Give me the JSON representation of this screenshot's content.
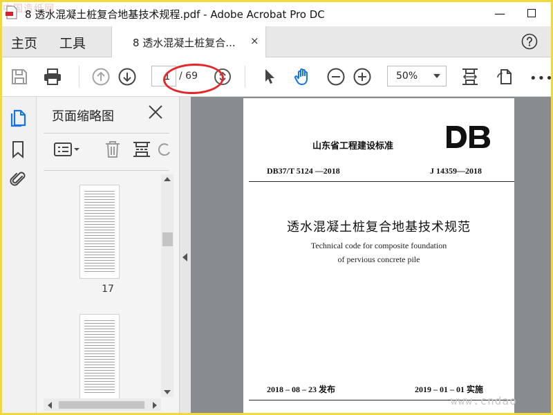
{
  "window": {
    "title": "8 透水混凝土桩复合地基技术规程.pdf - Adobe Acrobat Pro DC",
    "minimize_label": "—",
    "maximize_label": "☐"
  },
  "watermarks": {
    "top_left": "中国造纸网",
    "bottom_right": "www.cndao"
  },
  "tabs": {
    "home": "主页",
    "tools": "工具",
    "document": "8 透水混凝土桩复合...",
    "close": "×"
  },
  "toolbar": {
    "page_current": "1",
    "page_total": "/ 69",
    "zoom": "50%",
    "more": "•••"
  },
  "thumbnail_panel": {
    "title": "页面缩略图",
    "thumbnails": [
      {
        "label": "17"
      },
      {
        "label": ""
      }
    ]
  },
  "document_page": {
    "org": "山东省工程建设标准",
    "logo_text": "DB",
    "code_left": "DB37/T 5124 —2018",
    "code_right": "J 14359—2018",
    "title_zh": "透水混凝土桩复合地基技术规范",
    "title_en_line1": "Technical code for composite foundation",
    "title_en_line2": "of pervious concrete pile",
    "published": "2018 – 08 – 23  发布",
    "implemented": "2019 – 01 – 01  实施"
  },
  "colors": {
    "accent_blue": "#1473e6",
    "highlight_red": "#e5262a",
    "frame_yellow": "#f3d83a"
  }
}
